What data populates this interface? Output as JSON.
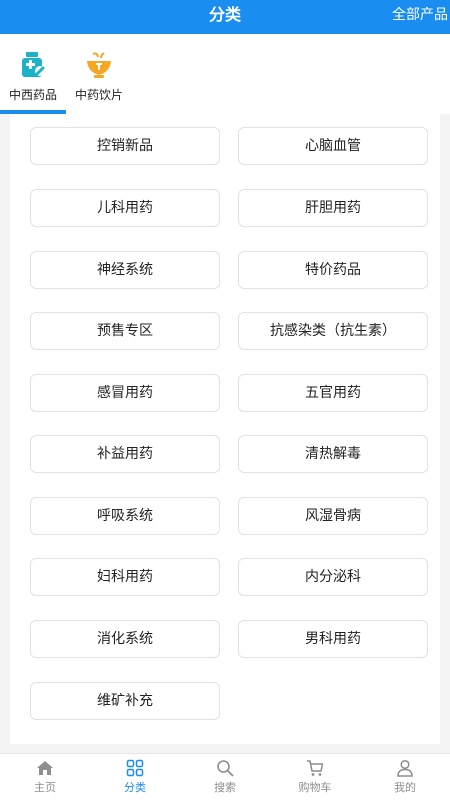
{
  "header": {
    "title": "分类",
    "right_link": "全部产品"
  },
  "tabs": [
    {
      "label": "中西药品",
      "icon": "medicine-bottle-icon",
      "active": true
    },
    {
      "label": "中药饮片",
      "icon": "herb-bowl-icon",
      "active": false
    }
  ],
  "categories": [
    "控销新品",
    "心脑血管",
    "儿科用药",
    "肝胆用药",
    "神经系统",
    "特价药品",
    "预售专区",
    "抗感染类（抗生素）",
    "感冒用药",
    "五官用药",
    "补益用药",
    "清热解毒",
    "呼吸系统",
    "风湿骨病",
    "妇科用药",
    "内分泌科",
    "消化系统",
    "男科用药",
    "维矿补充"
  ],
  "bottom_nav": [
    {
      "label": "主页",
      "icon": "home-icon",
      "active": false
    },
    {
      "label": "分类",
      "icon": "grid-icon",
      "active": true
    },
    {
      "label": "搜索",
      "icon": "search-icon",
      "active": false
    },
    {
      "label": "购物车",
      "icon": "cart-icon",
      "active": false
    },
    {
      "label": "我的",
      "icon": "user-icon",
      "active": false
    }
  ],
  "colors": {
    "accent": "#1a8ef0",
    "tab_icon_teal": "#1ab3c8",
    "tab_icon_orange": "#f5a623",
    "nav_inactive": "#8e8e8e"
  }
}
